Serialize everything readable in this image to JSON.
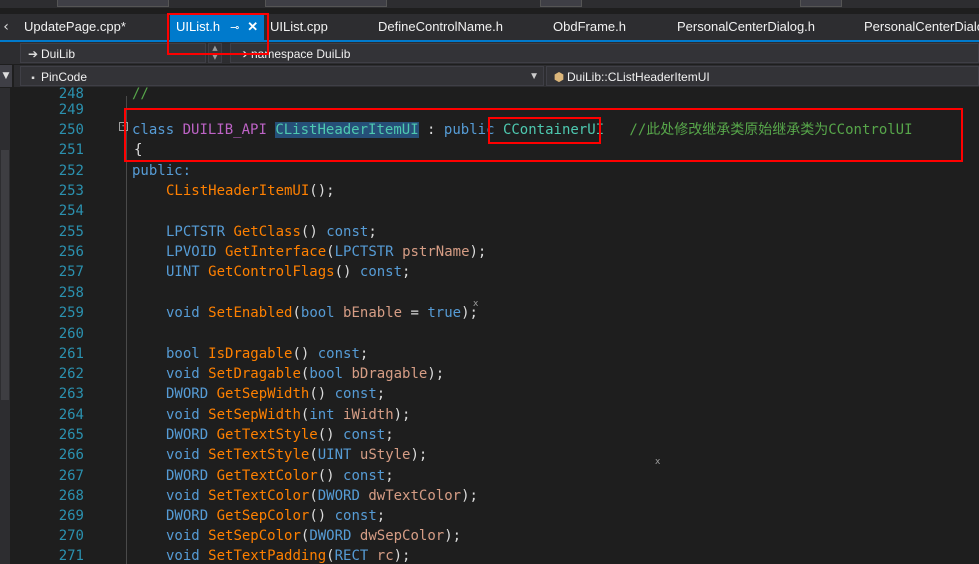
{
  "tabs": [
    {
      "label": "UpdatePage.cpp*"
    },
    {
      "label": "UIList.h",
      "pin": "⊸",
      "close": "✕"
    },
    {
      "label": "UIList.cpp"
    },
    {
      "label": "DefineControlName.h"
    },
    {
      "label": "ObdFrame.h"
    },
    {
      "label": "PersonalCenterDialog.h"
    },
    {
      "label": "PersonalCenterDialo"
    }
  ],
  "nav": {
    "project": "DuiLib",
    "scope": "namespace DuiLib",
    "member": "PinCode",
    "symbol": "DuiLib::CListHeaderItemUI"
  },
  "icons": {
    "nav_arrow": "arrow-right-icon",
    "dropdown": "chevron-down-icon",
    "class": "class-icon"
  },
  "code": {
    "lines": [
      {
        "n": "248"
      },
      {
        "n": "249"
      },
      {
        "n": "250"
      },
      {
        "n": "251"
      },
      {
        "n": "252"
      },
      {
        "n": "253"
      },
      {
        "n": "254"
      },
      {
        "n": "255"
      },
      {
        "n": "256"
      },
      {
        "n": "257"
      },
      {
        "n": "258"
      },
      {
        "n": "259"
      },
      {
        "n": "260"
      },
      {
        "n": "261"
      },
      {
        "n": "262"
      },
      {
        "n": "263"
      },
      {
        "n": "264"
      },
      {
        "n": "265"
      },
      {
        "n": "266"
      },
      {
        "n": "267"
      },
      {
        "n": "268"
      },
      {
        "n": "269"
      },
      {
        "n": "270"
      },
      {
        "n": "271"
      }
    ],
    "t": {
      "l248": "//",
      "class_kw": "class",
      "api": "DUILIB_API",
      "cls_name": "CListHeaderItemUI",
      "colon": " : ",
      "public_kw": "public",
      "base": "CContainerUI",
      "comment": "//此处修改继承类原始继承类为CControlUI",
      "brace": "{",
      "public_label": "public:",
      "ctor": "CListHeaderItemUI",
      "ctor_tail": "();",
      "lpctstr": "LPCTSTR",
      "getclass": "GetClass",
      "const_kw": "const",
      "lpvoid": "LPVOID",
      "getinterface": "GetInterface",
      "pstrname": "pstrName",
      "uint": "UINT",
      "getcontrolflags": "GetControlFlags",
      "void_kw": "void",
      "setenabled": "SetEnabled",
      "bool_kw": "bool",
      "benable": "bEnable",
      "true_kw": "true",
      "isdragable": "IsDragable",
      "setdragable": "SetDragable",
      "bdragable": "bDragable",
      "dword": "DWORD",
      "getsepwidth": "GetSepWidth",
      "setsepwidth": "SetSepWidth",
      "int_kw": "int",
      "iwidth": "iWidth",
      "gettextstyle": "GetTextStyle",
      "settextstyle": "SetTextStyle",
      "ustyle": "uStyle",
      "gettextcolor": "GetTextColor",
      "settextcolor": "SetTextColor",
      "dwtextcolor": "dwTextColor",
      "getsepcolor": "GetSepColor",
      "setsepcolor": "SetSepColor",
      "dwsepcolor": "dwSepColor",
      "settextpadding": "SetTextPadding",
      "rect": "RECT",
      "rc": "rc"
    },
    "marks": {
      "x1": "x",
      "x2": "x",
      "collapse": "-"
    }
  },
  "colors": {
    "accent": "#007acc",
    "annotation": "#ff0000",
    "keyword": "#569cd6",
    "type": "#4ec9b0",
    "function": "#ff8000",
    "comment": "#57a64a",
    "parameter": "#d69d85",
    "macro": "#bd63c5",
    "line_number": "#2b91af"
  }
}
